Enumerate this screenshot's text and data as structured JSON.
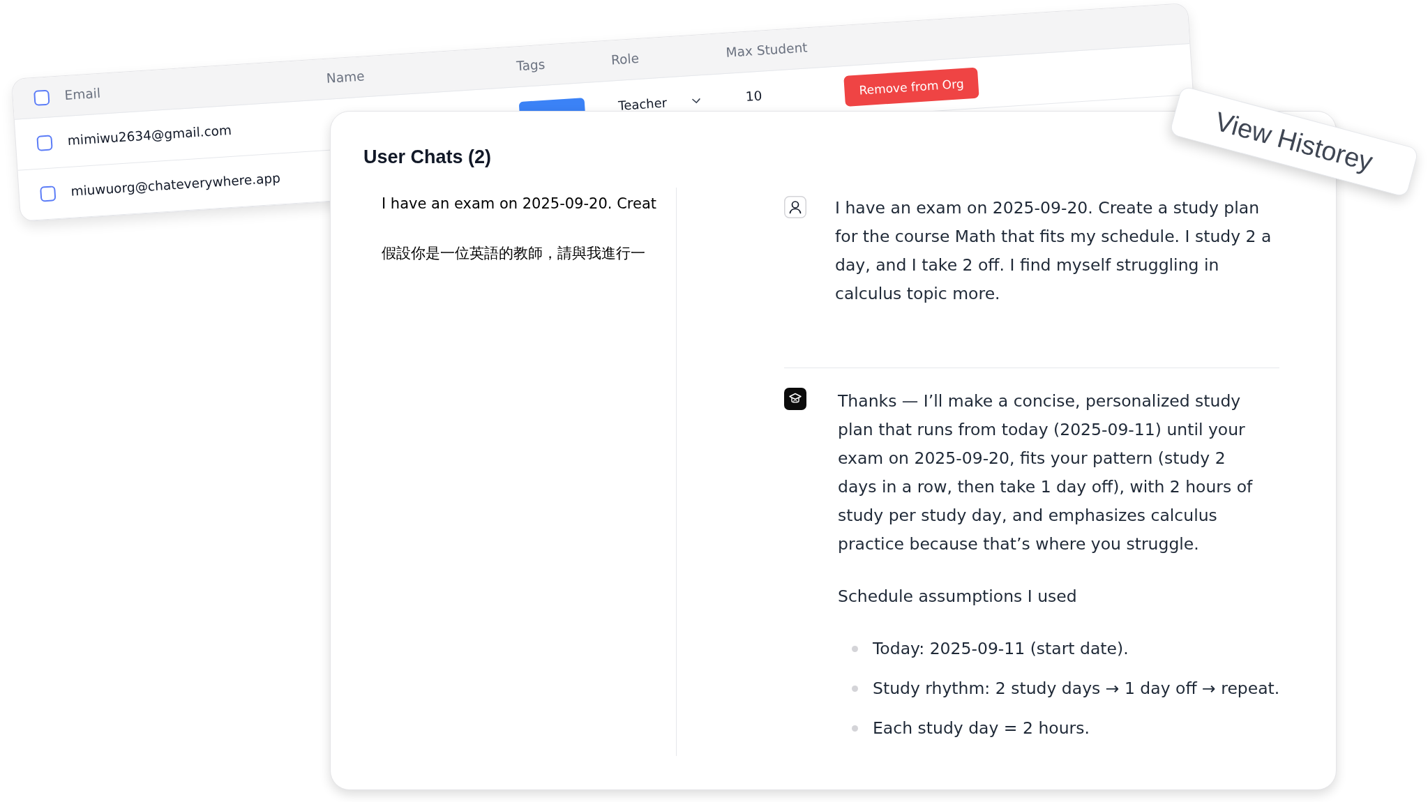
{
  "members_table": {
    "select_all": {
      "checked": false
    },
    "columns": [
      "Email",
      "Name",
      "Tags",
      "Role",
      "Max Student"
    ],
    "rows": [
      {
        "checked": false,
        "email": "mimiwu2634@gmail.com",
        "tag_badge": true,
        "role": "Teacher",
        "max_student": "10",
        "action": "Remove from Org"
      },
      {
        "checked": false,
        "email": "miuwuorg@chateverywhere.app"
      }
    ]
  },
  "dialog": {
    "title": "User Chats (2)",
    "chats": [
      "I have an exam on 2025-09-20. Creat",
      "假設你是一位英語的教師，請與我進行一"
    ],
    "messages": [
      {
        "kind": "user",
        "blocks": [
          {
            "kind": "paragraph",
            "text": "I have an exam on 2025-09-20. Create a study plan for the course Math that fits my schedule. I study 2 a day, and I take 2 off. I find myself struggling in calculus topic more."
          }
        ]
      },
      {
        "kind": "assistant",
        "blocks": [
          {
            "kind": "paragraph",
            "text": "Thanks — I’ll make a concise, personalized study plan that runs from today (2025-09-11) until your exam on 2025-09-20, fits your pattern (study 2 days in a row, then take 1 day off), with 2 hours of study per study day, and emphasizes calculus practice because that’s where you struggle."
          },
          {
            "kind": "paragraph",
            "text": "Schedule assumptions I used"
          },
          {
            "kind": "bullets",
            "items": [
              "Today: 2025-09-11 (start date).",
              "Study rhythm: 2 study days → 1 day off → repeat.",
              "Each study day = 2 hours."
            ]
          }
        ]
      }
    ]
  },
  "callout": {
    "label": "View Historey"
  }
}
